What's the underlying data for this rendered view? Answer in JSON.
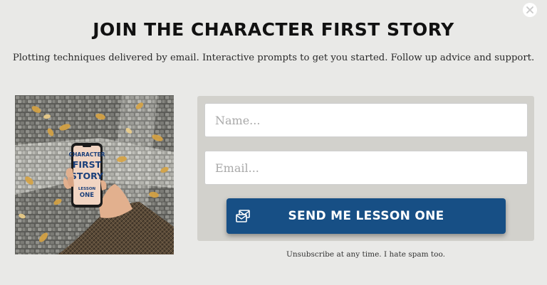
{
  "modal": {
    "title": "JOIN THE CHARACTER FIRST STORY",
    "subtitle": "Plotting techniques delivered by email. Interactive prompts to get you started. Follow up advice and support.",
    "disclaimer": "Unsubscribe at any time. I hate spam too."
  },
  "image": {
    "phone_line1": "CHARACTER",
    "phone_line2": "FIRST",
    "phone_line3": "STORY",
    "phone_line4": "LESSON",
    "phone_line5": "ONE"
  },
  "form": {
    "name_placeholder": "Name...",
    "name_value": "",
    "email_placeholder": "Email...",
    "email_value": "",
    "submit_label": "SEND ME LESSON ONE"
  },
  "icons": {
    "close": "close-icon",
    "submit": "mail-send-icon"
  },
  "colors": {
    "background": "#e9e9e7",
    "panel": "#d2d1cc",
    "button": "#174f85",
    "button_text": "#ffffff",
    "title": "#111111"
  }
}
